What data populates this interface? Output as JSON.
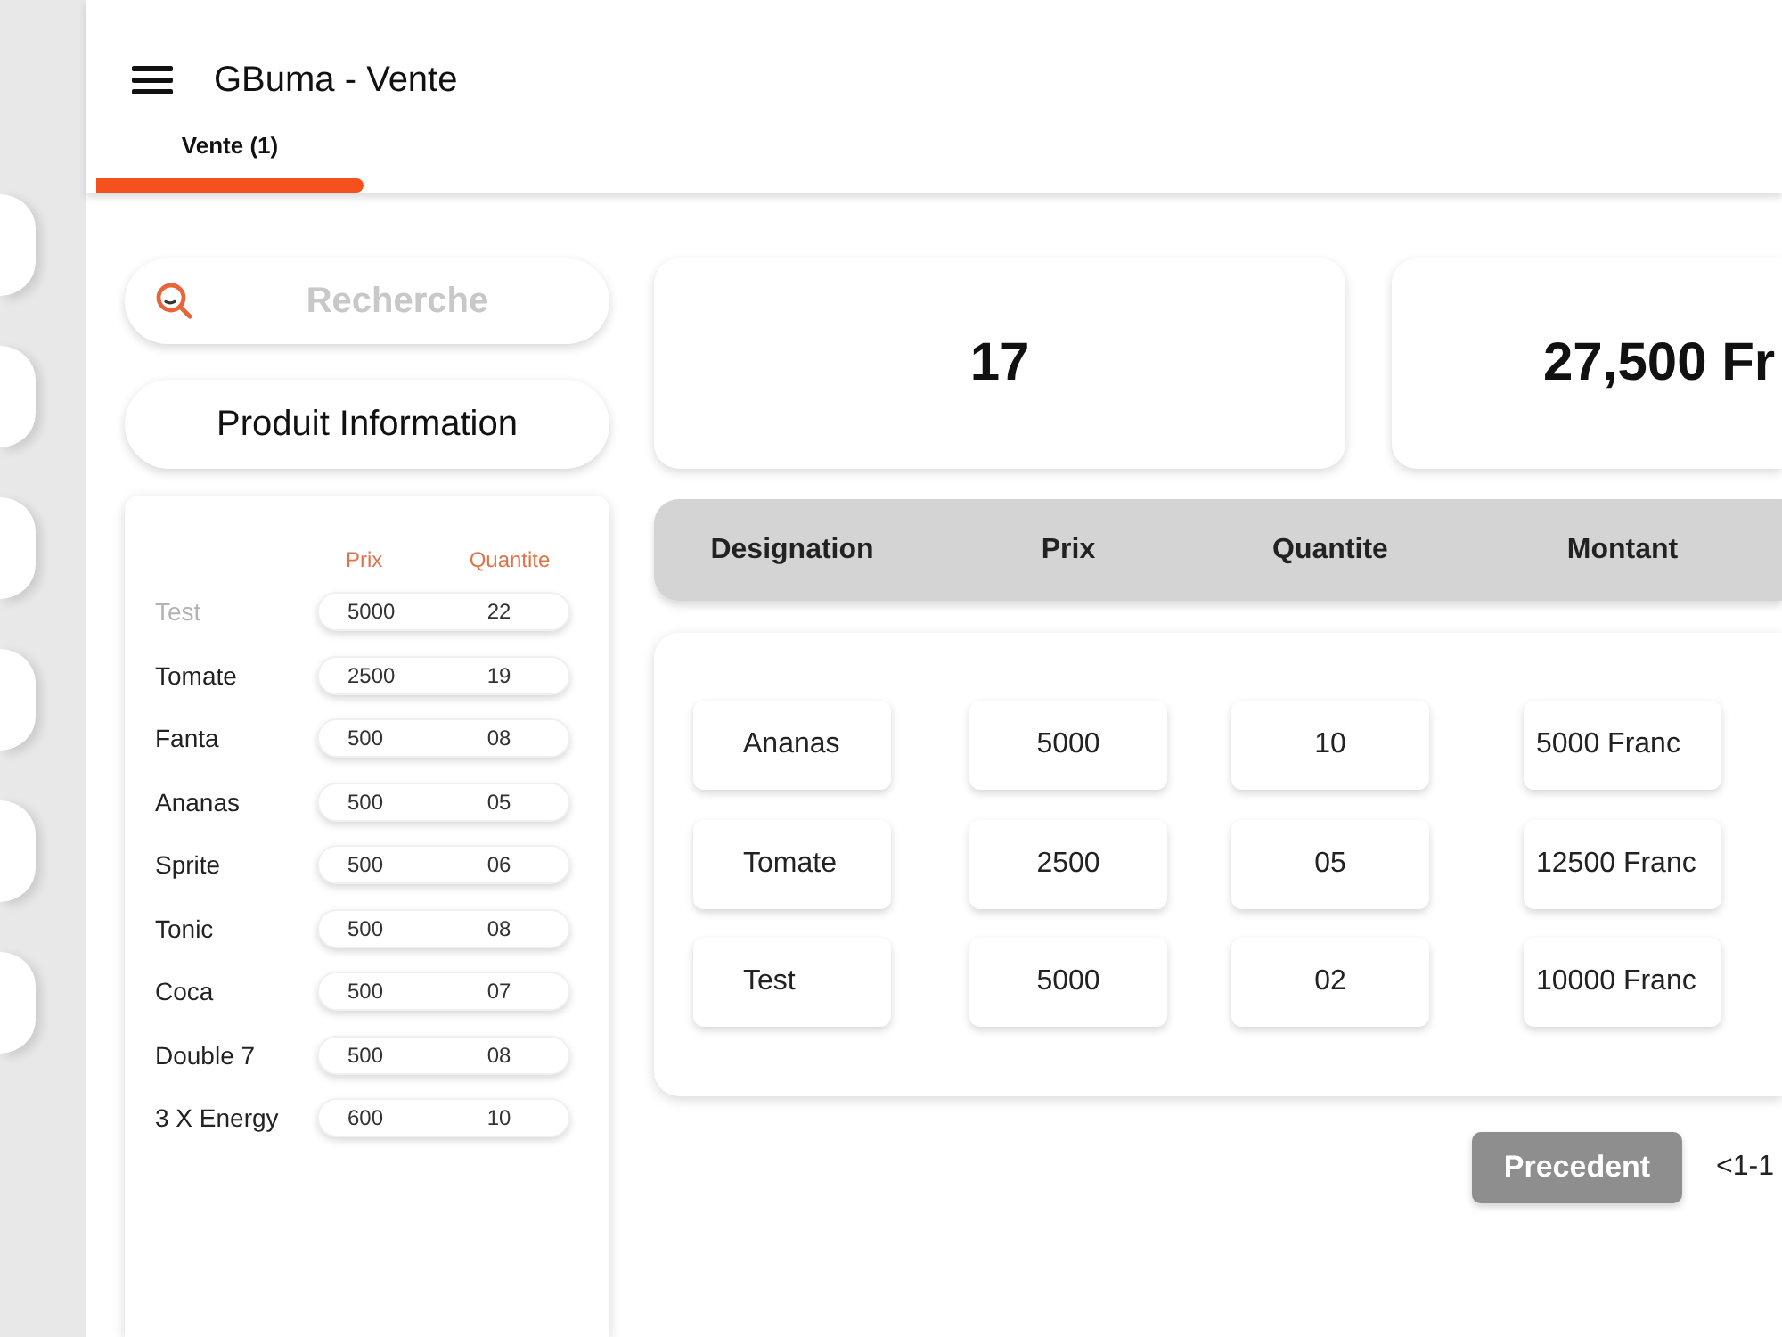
{
  "app_bar": {
    "title": "GBuma - Vente"
  },
  "tabs": [
    {
      "label": "Vente (1)",
      "selected": true
    }
  ],
  "search": {
    "placeholder": "Recherche"
  },
  "product_info_button": {
    "label": "Produit Information"
  },
  "product_list": {
    "columns": [
      "Prix",
      "Quantite"
    ],
    "items": [
      {
        "name": "Test",
        "price": "5000",
        "quantity": "22",
        "disabled": true
      },
      {
        "name": "Tomate",
        "price": "2500",
        "quantity": "19",
        "disabled": false
      },
      {
        "name": "Fanta",
        "price": "500",
        "quantity": "08",
        "disabled": false
      },
      {
        "name": "Ananas",
        "price": "500",
        "quantity": "05",
        "disabled": false
      },
      {
        "name": "Sprite",
        "price": "500",
        "quantity": "06",
        "disabled": false
      },
      {
        "name": "Tonic",
        "price": "500",
        "quantity": "08",
        "disabled": false
      },
      {
        "name": "Coca",
        "price": "500",
        "quantity": "07",
        "disabled": false
      },
      {
        "name": "Double 7",
        "price": "500",
        "quantity": "08",
        "disabled": false
      },
      {
        "name": "3 X Energy",
        "price": "600",
        "quantity": "10",
        "disabled": false
      }
    ]
  },
  "summary": [
    "17",
    "27,500 Fr"
  ],
  "cart_table": {
    "columns": [
      "Designation",
      "Prix",
      "Quantite",
      "Montant"
    ],
    "rows": [
      [
        "Ananas",
        "5000",
        "10",
        "5000 Franc"
      ],
      [
        "Tomate",
        "2500",
        "05",
        "12500 Franc"
      ],
      [
        "Test",
        "5000",
        "02",
        "10000 Franc"
      ]
    ]
  },
  "pagination": {
    "previous": {
      "label": "Precedent",
      "disabled": true
    },
    "range": "<1-1"
  }
}
